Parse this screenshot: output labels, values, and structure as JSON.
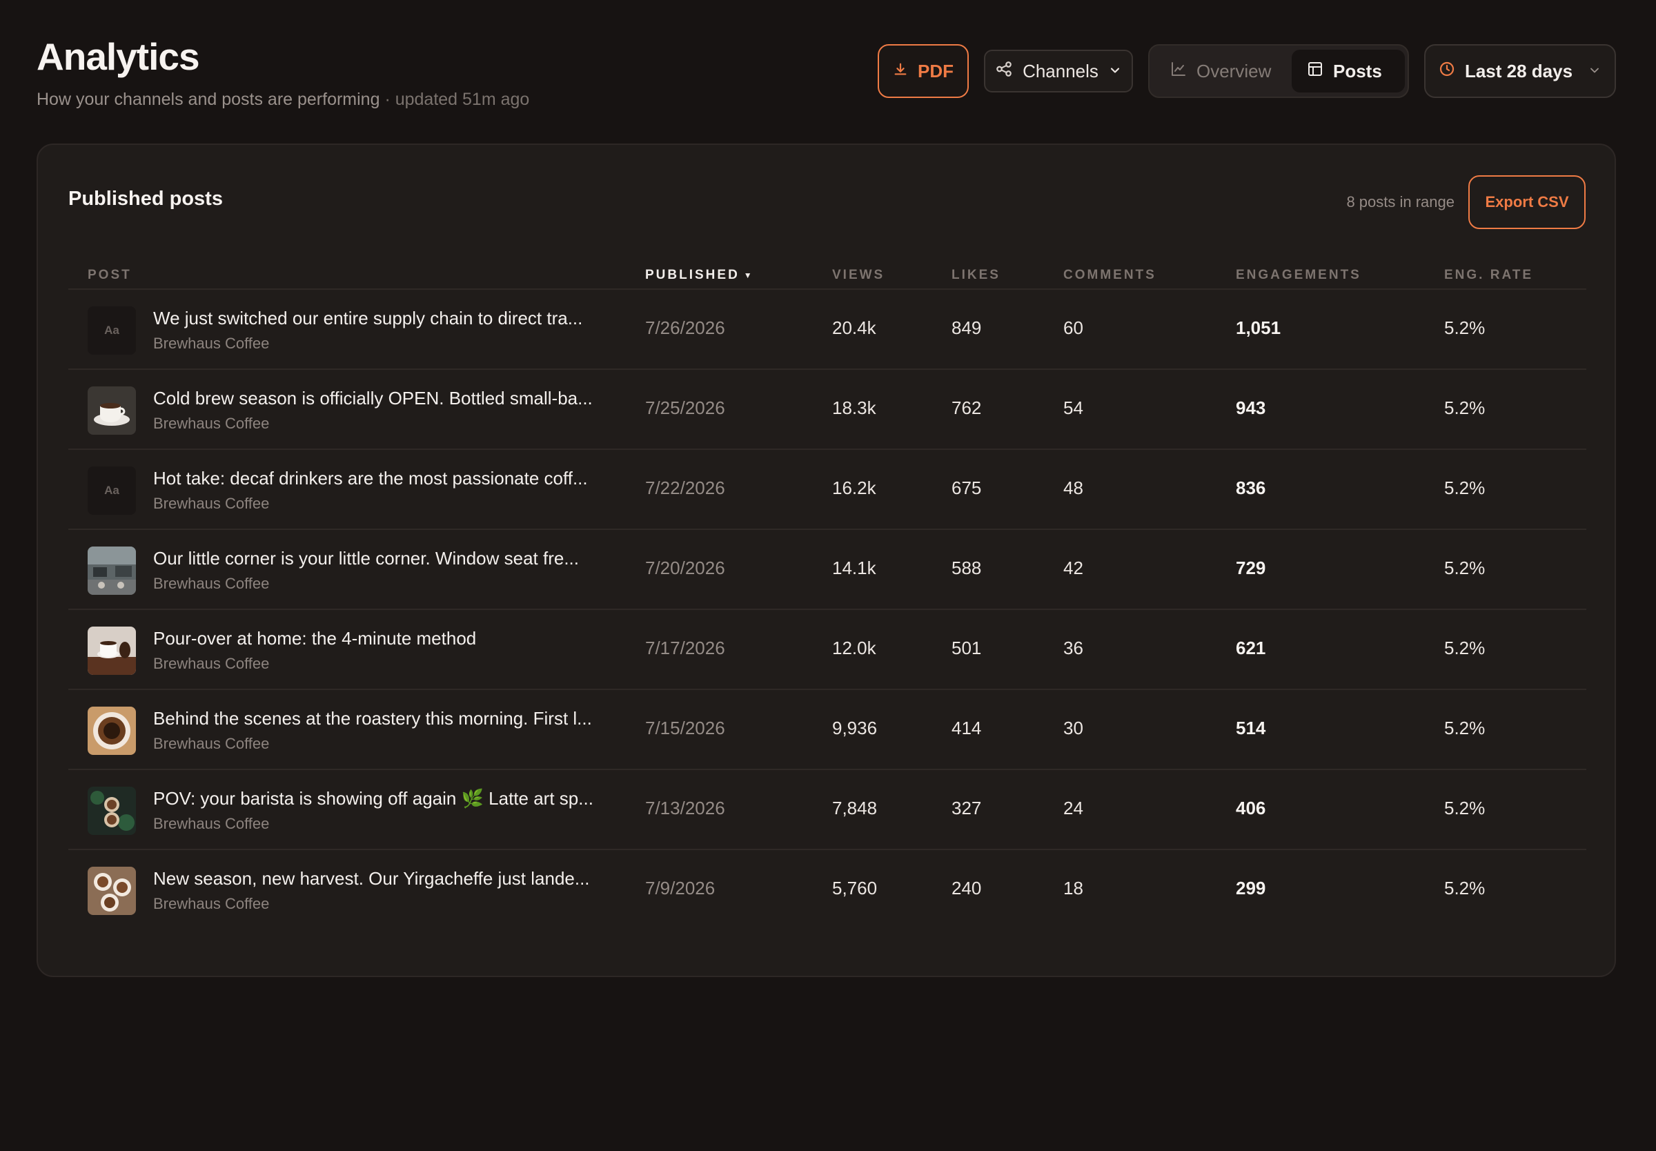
{
  "header": {
    "title": "Analytics",
    "subtitle": "How your channels and posts are performing",
    "updated": " · updated 51m ago"
  },
  "toolbar": {
    "pdf_label": "PDF",
    "channels_label": "Channels",
    "overview_label": "Overview",
    "posts_label": "Posts",
    "range_label": "Last 28 days",
    "active_view": "Posts"
  },
  "colors": {
    "accent": "#ef7b45",
    "background": "#171312",
    "card": "#201c1a"
  },
  "card": {
    "title": "Published posts",
    "count_text": "8 posts in range",
    "export_label": "Export CSV"
  },
  "table": {
    "columns": [
      "POST",
      "PUBLISHED",
      "VIEWS",
      "LIKES",
      "COMMENTS",
      "ENGAGEMENTS",
      "ENG. RATE"
    ],
    "sorted_column": "PUBLISHED",
    "sort_direction": "desc",
    "rows": [
      {
        "title": "We just switched our entire supply chain to direct tra...",
        "account": "Brewhaus Coffee",
        "thumb": "text",
        "thumb_text": "Aa",
        "published": "7/26/2026",
        "views": "20.4k",
        "likes": "849",
        "comments": "60",
        "engagements": "1,051",
        "rate": "5.2%"
      },
      {
        "title": "Cold brew season is officially OPEN. Bottled small-ba...",
        "account": "Brewhaus Coffee",
        "thumb": "cup-photo",
        "published": "7/25/2026",
        "views": "18.3k",
        "likes": "762",
        "comments": "54",
        "engagements": "943",
        "rate": "5.2%"
      },
      {
        "title": "Hot take: decaf drinkers are the most passionate coff...",
        "account": "Brewhaus Coffee",
        "thumb": "text",
        "thumb_text": "Aa",
        "published": "7/22/2026",
        "views": "16.2k",
        "likes": "675",
        "comments": "48",
        "engagements": "836",
        "rate": "5.2%"
      },
      {
        "title": "Our little corner is your little corner. Window seat fre...",
        "account": "Brewhaus Coffee",
        "thumb": "cafe-photo",
        "published": "7/20/2026",
        "views": "14.1k",
        "likes": "588",
        "comments": "42",
        "engagements": "729",
        "rate": "5.2%"
      },
      {
        "title": "Pour-over at home: the 4-minute method",
        "account": "Brewhaus Coffee",
        "thumb": "beans-photo",
        "published": "7/17/2026",
        "views": "12.0k",
        "likes": "501",
        "comments": "36",
        "engagements": "621",
        "rate": "5.2%"
      },
      {
        "title": "Behind the scenes at the roastery this morning. First l...",
        "account": "Brewhaus Coffee",
        "thumb": "latte-photo",
        "published": "7/15/2026",
        "views": "9,936",
        "likes": "414",
        "comments": "30",
        "engagements": "514",
        "rate": "5.2%"
      },
      {
        "title": "POV: your barista is showing off again 🌿 Latte art sp...",
        "account": "Brewhaus Coffee",
        "thumb": "cups-photo",
        "published": "7/13/2026",
        "views": "7,848",
        "likes": "327",
        "comments": "24",
        "engagements": "406",
        "rate": "5.2%"
      },
      {
        "title": "New season, new harvest. Our Yirgacheffe just lande...",
        "account": "Brewhaus Coffee",
        "thumb": "cheers-photo",
        "published": "7/9/2026",
        "views": "5,760",
        "likes": "240",
        "comments": "18",
        "engagements": "299",
        "rate": "5.2%"
      }
    ]
  }
}
